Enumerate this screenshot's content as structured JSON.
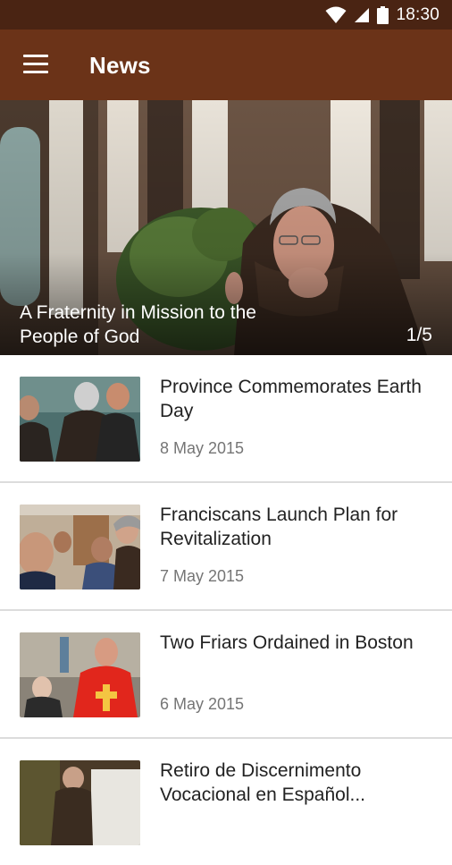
{
  "status_bar": {
    "time": "18:30",
    "icons": [
      "wifi-icon",
      "signal-icon",
      "battery-icon"
    ]
  },
  "app_bar": {
    "title": "News",
    "menu_icon": "menu-icon"
  },
  "colors": {
    "status_bar": "#4a2413",
    "app_bar": "#6b3318",
    "divider": "#dcdcdc",
    "date_text": "#757575"
  },
  "featured": {
    "title": "A Fraternity in Mission to the People of God",
    "counter": "1/5",
    "slide_index": 1,
    "slide_count": 5
  },
  "news": [
    {
      "headline": "Province Commemorates Earth Day",
      "date": "8 May 2015"
    },
    {
      "headline": "Franciscans Launch Plan for Revitalization",
      "date": "7 May 2015"
    },
    {
      "headline": "Two Friars Ordained in Boston",
      "date": "6 May 2015"
    },
    {
      "headline": "Retiro de Discernimento Vocacional en Español...",
      "date": ""
    }
  ]
}
